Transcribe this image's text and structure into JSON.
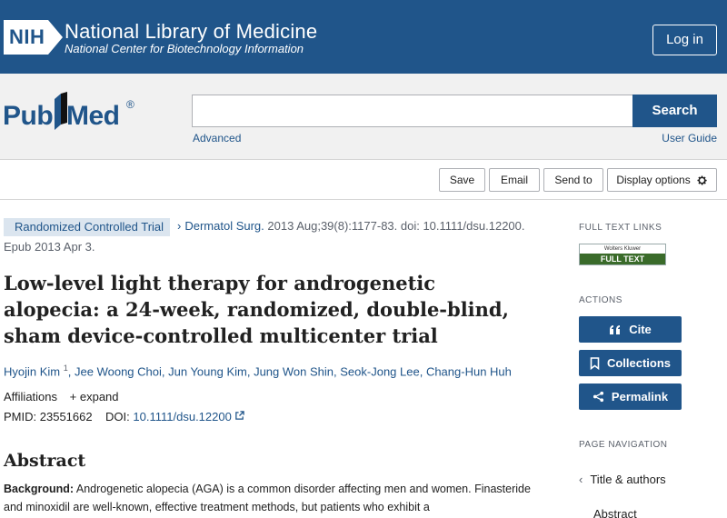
{
  "banner": {
    "logo_text": "NIH",
    "title": "National Library of Medicine",
    "subtitle": "National Center for Biotechnology Information",
    "login_label": "Log in"
  },
  "search": {
    "logo_pub": "Pub",
    "logo_med": "Med",
    "logo_reg": "®",
    "input_value": "",
    "button_label": "Search",
    "advanced_label": "Advanced",
    "user_guide_label": "User Guide"
  },
  "toolbar": {
    "save": "Save",
    "email": "Email",
    "send_to": "Send to",
    "display_options": "Display options"
  },
  "article": {
    "publication_type": "Randomized Controlled Trial",
    "journal": "Dermatol Surg.",
    "citation": "2013 Aug;39(8):1177-83. doi: 10.1111/dsu.12200.",
    "epub": "Epub 2013 Apr 3.",
    "title": "Low-level light therapy for androgenetic alopecia: a 24-week, randomized, double-blind, sham device-controlled multicenter trial",
    "authors": [
      {
        "name": "Hyojin Kim",
        "sup": "1"
      },
      {
        "name": "Jee Woong Choi"
      },
      {
        "name": "Jun Young Kim"
      },
      {
        "name": "Jung Won Shin"
      },
      {
        "name": "Seok-Jong Lee"
      },
      {
        "name": "Chang-Hun Huh"
      }
    ],
    "affiliations_label": "Affiliations",
    "expand_label": "expand",
    "pmid_label": "PMID:",
    "pmid": "23551662",
    "doi_label": "DOI:",
    "doi": "10.1111/dsu.12200",
    "abstract_heading": "Abstract",
    "abstract_bold": "Background:",
    "abstract_text": "Androgenetic alopecia (AGA) is a common disorder affecting men and women. Finasteride and minoxidil are well-known, effective treatment methods, but patients who exhibit a"
  },
  "sidebar": {
    "full_text_links_heading": "FULL TEXT LINKS",
    "full_text_badge_top": "Wolters Kluwer",
    "full_text_badge_bottom": "FULL TEXT",
    "actions_heading": "ACTIONS",
    "cite_label": "Cite",
    "collections_label": "Collections",
    "permalink_label": "Permalink",
    "page_nav_heading": "PAGE NAVIGATION",
    "nav_items": [
      "Title & authors",
      "Abstract"
    ]
  },
  "colors": {
    "brand_blue": "#20558a",
    "pub_type_bg": "#dbe5ef",
    "full_text_green": "#3a6b2a"
  }
}
